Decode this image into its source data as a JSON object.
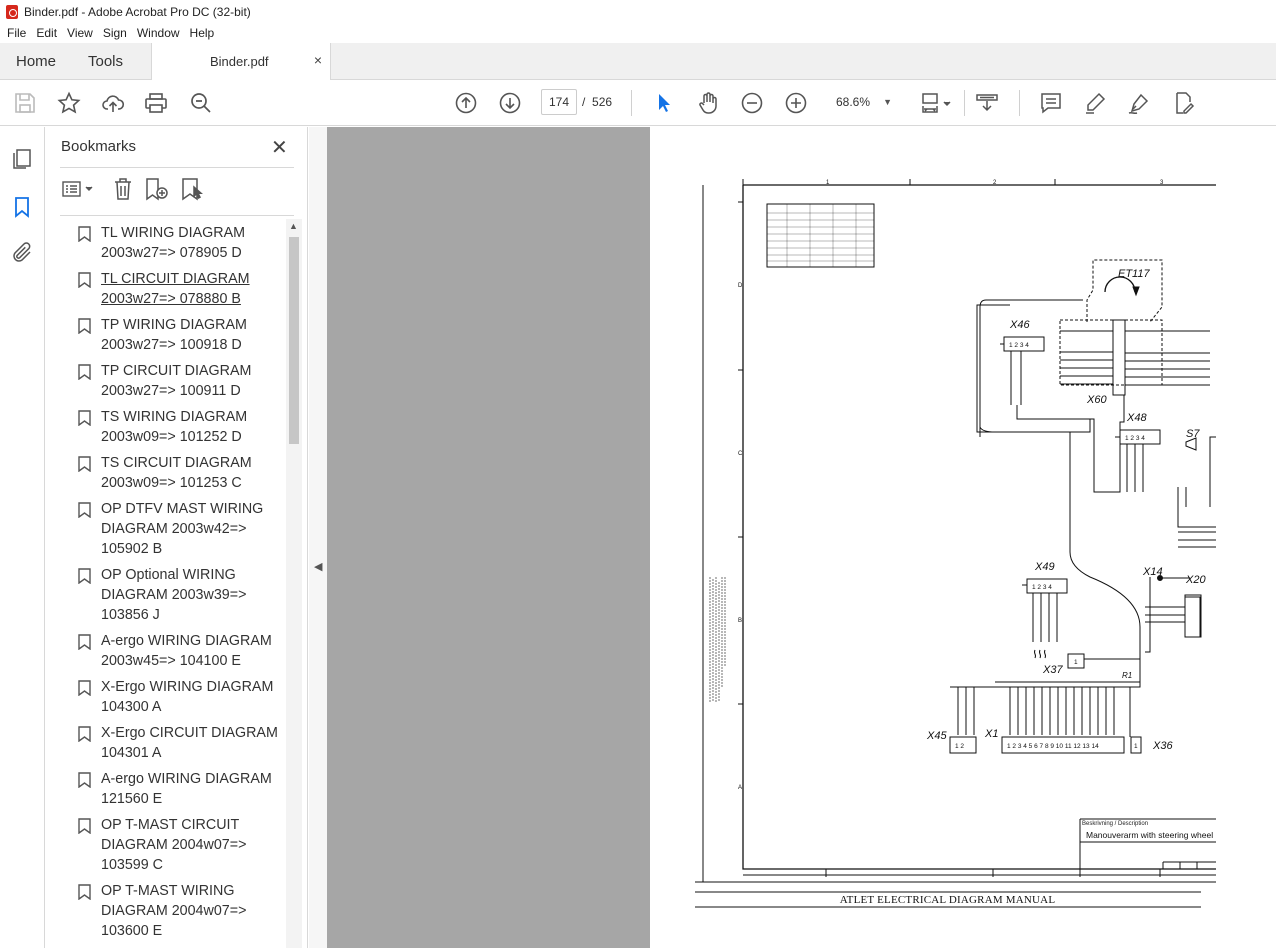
{
  "window": {
    "title": "Binder.pdf - Adobe Acrobat Pro DC (32-bit)"
  },
  "menu": [
    "File",
    "Edit",
    "View",
    "Sign",
    "Window",
    "Help"
  ],
  "tabs": {
    "home": "Home",
    "tools": "Tools",
    "document": "Binder.pdf",
    "close": "×"
  },
  "toolbar": {
    "page_current": "174",
    "page_separator": "/",
    "page_total": "526",
    "zoom": "68.6%"
  },
  "bookmarks": {
    "title": "Bookmarks",
    "items": [
      {
        "line1": "TL WIRING DIAGRAM",
        "line2": "2003w27=> 078905 D",
        "line3": ""
      },
      {
        "line1": "TL CIRCUIT DIAGRAM",
        "line2": "2003w27=> 078880 B",
        "line3": "",
        "active": true
      },
      {
        "line1": "TP WIRING DIAGRAM",
        "line2": "2003w27=> 100918 D",
        "line3": ""
      },
      {
        "line1": "TP CIRCUIT DIAGRAM",
        "line2": "2003w27=> 100911 D",
        "line3": ""
      },
      {
        "line1": "TS WIRING DIAGRAM",
        "line2": "2003w09=> 101252 D",
        "line3": ""
      },
      {
        "line1": "TS CIRCUIT DIAGRAM",
        "line2": "2003w09=> 101253 C",
        "line3": ""
      },
      {
        "line1": "OP DTFV MAST WIRING",
        "line2": "DIAGRAM 2003w42=>",
        "line3": "105902 B"
      },
      {
        "line1": "OP Optional WIRING",
        "line2": "DIAGRAM 2003w39=>",
        "line3": "103856 J"
      },
      {
        "line1": "A-ergo WIRING DIAGRAM",
        "line2": "2003w45=> 104100 E",
        "line3": ""
      },
      {
        "line1": "X-Ergo WIRING DIAGRAM",
        "line2": "104300 A",
        "line3": ""
      },
      {
        "line1": "X-Ergo CIRCUIT DIAGRAM",
        "line2": "104301 A",
        "line3": ""
      },
      {
        "line1": "A-ergo WIRING DIAGRAM",
        "line2": "121560 E",
        "line3": ""
      },
      {
        "line1": "OP T-MAST CIRCUIT",
        "line2": "DIAGRAM 2004w07=>",
        "line3": "103599 C"
      },
      {
        "line1": "OP T-MAST WIRING",
        "line2": "DIAGRAM 2004w07=>",
        "line3": "103600 E"
      }
    ]
  },
  "document": {
    "footer_title": "ATLET ELECTRICAL DIAGRAM MANUAL",
    "description_label": "Beskrivning / Description",
    "description": "Manouverarm with steering wheel",
    "labels": {
      "et117": "ET117",
      "x46": "X46",
      "x60": "X60",
      "x48": "X48",
      "s7": "S7",
      "x49": "X49",
      "x14": "X14",
      "x20": "X20",
      "x37": "X37",
      "r1": "R1",
      "x45": "X45",
      "x1": "X1",
      "x36": "X36"
    },
    "column_numbers": [
      "1",
      "2",
      "3"
    ],
    "row_letters": [
      "D",
      "C",
      "B",
      "A"
    ]
  }
}
